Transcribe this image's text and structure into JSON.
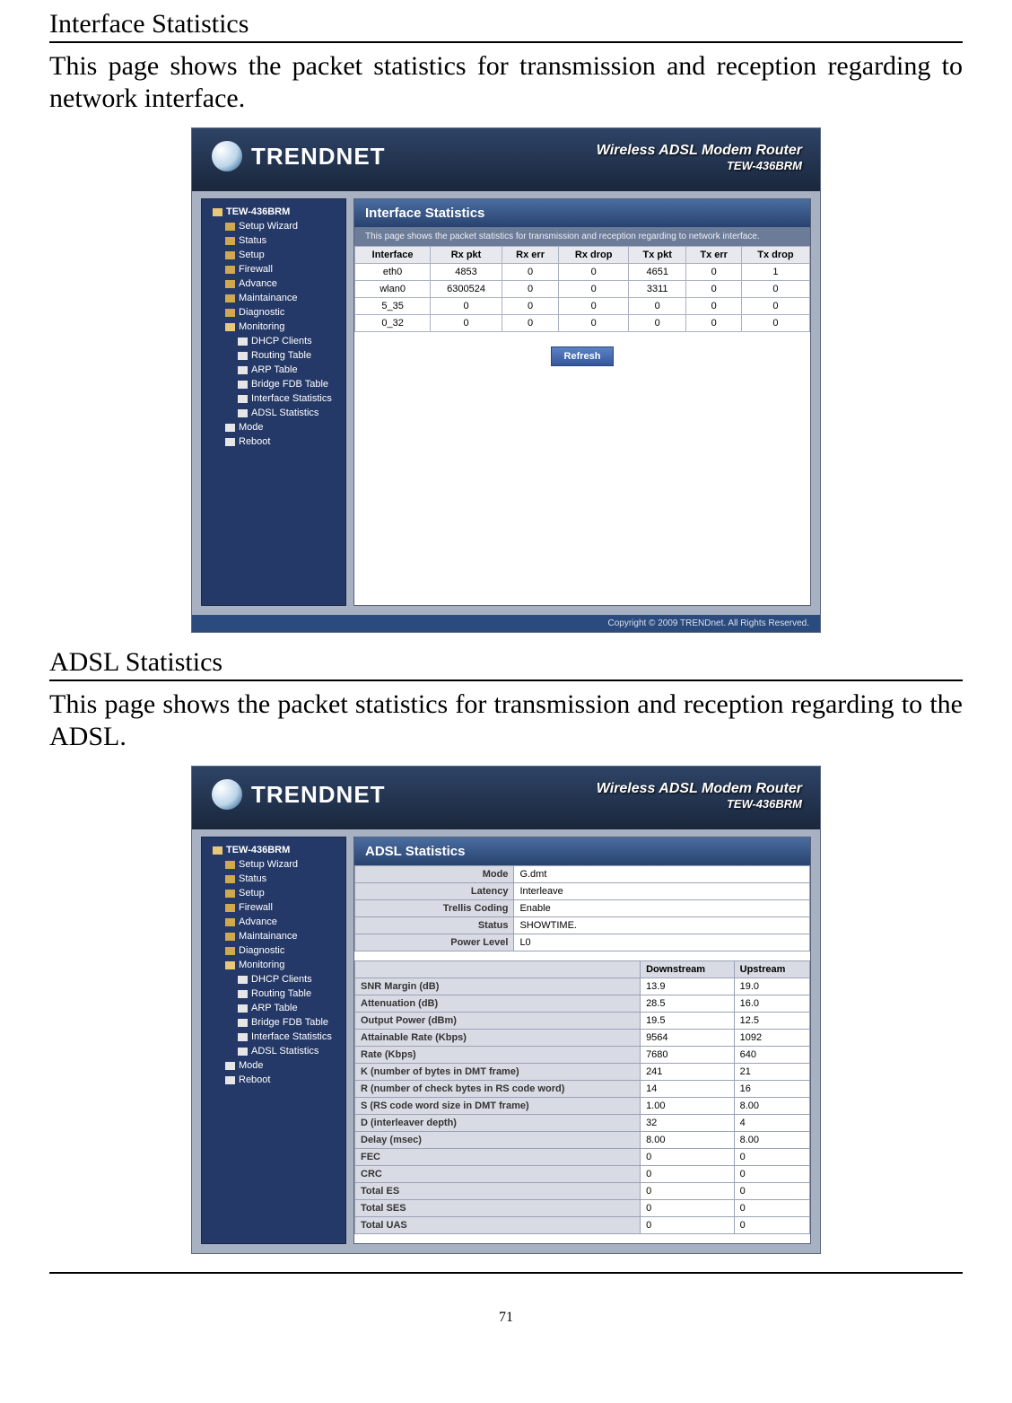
{
  "section1": {
    "title": "Interface Statistics",
    "body": "This page shows the packet statistics for transmission and reception regarding to network interface."
  },
  "section2": {
    "title": "ADSL Statistics",
    "body": "This page shows the packet statistics for transmission and reception regarding to the ADSL."
  },
  "brand": {
    "name": "TRENDNET",
    "product": "Wireless ADSL Modem Router",
    "model": "TEW-436BRM"
  },
  "nav": {
    "root": "TEW-436BRM",
    "items": [
      "Setup Wizard",
      "Status",
      "Setup",
      "Firewall",
      "Advance",
      "Maintainance",
      "Diagnostic",
      "Monitoring"
    ],
    "monitoring": [
      "DHCP Clients",
      "Routing Table",
      "ARP Table",
      "Bridge FDB Table",
      "Interface Statistics",
      "ADSL Statistics"
    ],
    "tail": [
      "Mode",
      "Reboot"
    ]
  },
  "shot1": {
    "title": "Interface Statistics",
    "desc": "This page shows the packet statistics for transmission and reception regarding to network interface.",
    "headers": [
      "Interface",
      "Rx pkt",
      "Rx err",
      "Rx drop",
      "Tx pkt",
      "Tx err",
      "Tx drop"
    ],
    "rows": [
      [
        "eth0",
        "4853",
        "0",
        "0",
        "4651",
        "0",
        "1"
      ],
      [
        "wlan0",
        "6300524",
        "0",
        "0",
        "3311",
        "0",
        "0"
      ],
      [
        "5_35",
        "0",
        "0",
        "0",
        "0",
        "0",
        "0"
      ],
      [
        "0_32",
        "0",
        "0",
        "0",
        "0",
        "0",
        "0"
      ]
    ],
    "refresh": "Refresh"
  },
  "shot2": {
    "title": "ADSL Statistics",
    "kv": [
      [
        "Mode",
        "G.dmt"
      ],
      [
        "Latency",
        "Interleave"
      ],
      [
        "Trellis Coding",
        "Enable"
      ],
      [
        "Status",
        "SHOWTIME."
      ],
      [
        "Power Level",
        "L0"
      ]
    ],
    "cols": [
      "",
      "Downstream",
      "Upstream"
    ],
    "rows": [
      [
        "SNR Margin (dB)",
        "13.9",
        "19.0"
      ],
      [
        "Attenuation (dB)",
        "28.5",
        "16.0"
      ],
      [
        "Output Power (dBm)",
        "19.5",
        "12.5"
      ],
      [
        "Attainable Rate (Kbps)",
        "9564",
        "1092"
      ],
      [
        "Rate (Kbps)",
        "7680",
        "640"
      ],
      [
        "K (number of bytes in DMT frame)",
        "241",
        "21"
      ],
      [
        "R (number of check bytes in RS code word)",
        "14",
        "16"
      ],
      [
        "S (RS code word size in DMT frame)",
        "1.00",
        "8.00"
      ],
      [
        "D (interleaver depth)",
        "32",
        "4"
      ],
      [
        "Delay (msec)",
        "8.00",
        "8.00"
      ],
      [
        "FEC",
        "0",
        "0"
      ],
      [
        "CRC",
        "0",
        "0"
      ],
      [
        "Total ES",
        "0",
        "0"
      ],
      [
        "Total SES",
        "0",
        "0"
      ],
      [
        "Total UAS",
        "0",
        "0"
      ]
    ]
  },
  "footer": "Copyright © 2009 TRENDnet. All Rights Reserved.",
  "page_number": "71"
}
